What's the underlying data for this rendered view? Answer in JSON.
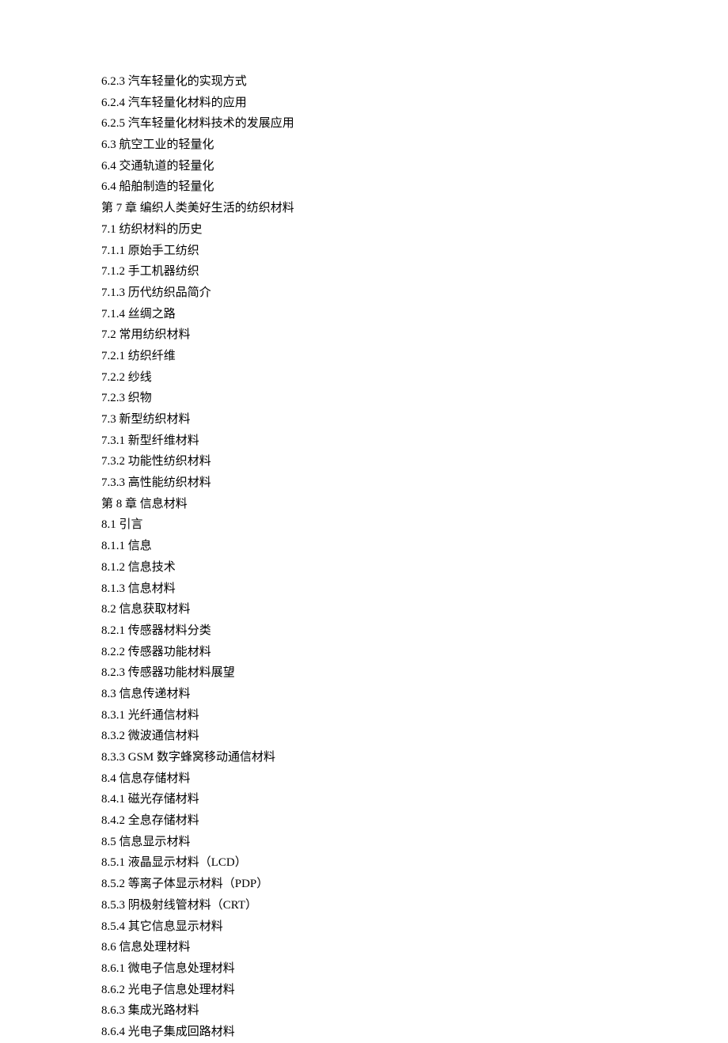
{
  "toc": [
    "6.2.3   汽车轻量化的实现方式",
    "6.2.4   汽车轻量化材料的应用",
    "6.2.5   汽车轻量化材料技术的发展应用",
    "6.3   航空工业的轻量化",
    "6.4   交通轨道的轻量化",
    "6.4   船舶制造的轻量化",
    "第 7 章   编织人类美好生活的纺织材料",
    "7.1   纺织材料的历史",
    "7.1.1   原始手工纺织",
    "7.1.2   手工机器纺织",
    "7.1.3   历代纺织品简介",
    "7.1.4   丝绸之路",
    "7.2   常用纺织材料",
    "7.2.1   纺织纤维",
    "7.2.2   纱线",
    "7.2.3   织物",
    "7.3   新型纺织材料",
    "7.3.1   新型纤维材料",
    "7.3.2   功能性纺织材料",
    "7.3.3   高性能纺织材料",
    "第 8 章   信息材料",
    "8.1   引言",
    "8.1.1   信息",
    "8.1.2   信息技术",
    "8.1.3   信息材料",
    "8.2   信息获取材料",
    "8.2.1 传感器材料分类",
    "8.2.2   传感器功能材料",
    "8.2.3   传感器功能材料展望",
    "8.3   信息传递材料",
    "8.3.1   光纤通信材料",
    "8.3.2   微波通信材料",
    "8.3.3   GSM 数字蜂窝移动通信材料",
    "8.4   信息存储材料",
    "8.4.1   磁光存储材料",
    "8.4.2   全息存储材料",
    "8.5   信息显示材料",
    "8.5.1   液晶显示材料（LCD）",
    "8.5.2   等离子体显示材料（PDP）",
    "8.5.3   阴极射线管材料（CRT）",
    "8.5.4   其它信息显示材料",
    "8.6   信息处理材料",
    "8.6.1   微电子信息处理材料",
    "8.6.2   光电子信息处理材料",
    "8.6.3   集成光路材料",
    "8.6.4   光电子集成回路材料"
  ]
}
